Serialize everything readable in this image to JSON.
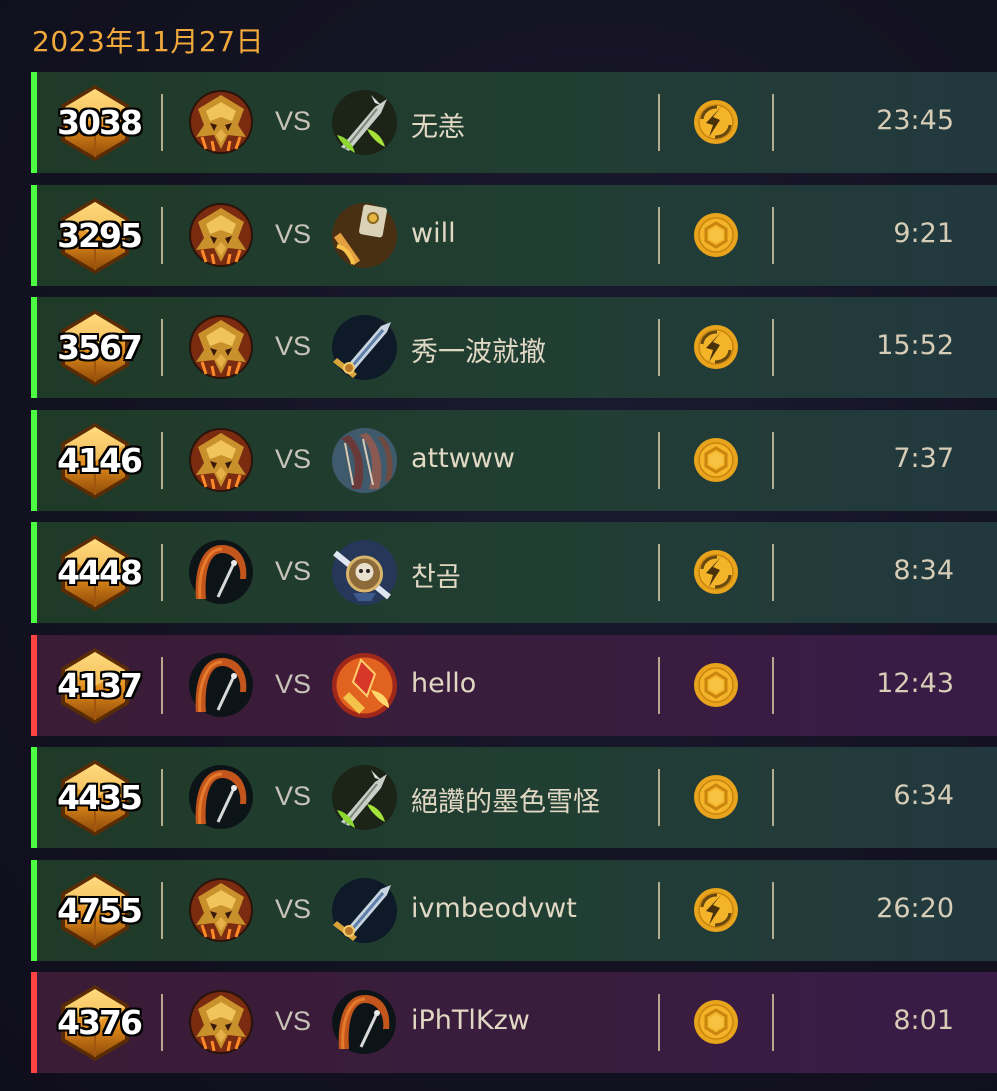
{
  "date": "2023年11月27日",
  "vs_label": "VS",
  "colors": {
    "accent": "#f2a93b",
    "win_bar": "#4cff43",
    "loss_bar": "#ff4242"
  },
  "matches": [
    {
      "result": "win",
      "rating": "3038",
      "my_hero": "tribal-mask-icon",
      "opponent_hero": "sword-green-icon",
      "opponent": "无恙",
      "mode": "swirl-mode-icon",
      "duration": "23:45"
    },
    {
      "result": "win",
      "rating": "3295",
      "my_hero": "tribal-mask-icon",
      "opponent_hero": "hammer-icon",
      "opponent": "will",
      "mode": "hexagon-mode-icon",
      "duration": "9:21"
    },
    {
      "result": "win",
      "rating": "3567",
      "my_hero": "tribal-mask-icon",
      "opponent_hero": "sword-blue-icon",
      "opponent": "秀一波就撤",
      "mode": "swirl-mode-icon",
      "duration": "15:52"
    },
    {
      "result": "win",
      "rating": "4146",
      "my_hero": "tribal-mask-icon",
      "opponent_hero": "claw-icon",
      "opponent": "attwww",
      "mode": "hexagon-mode-icon",
      "duration": "7:37"
    },
    {
      "result": "win",
      "rating": "4448",
      "my_hero": "hooded-staff-icon",
      "opponent_hero": "skull-shield-icon",
      "opponent": "찬곰",
      "mode": "swirl-mode-icon",
      "duration": "8:34"
    },
    {
      "result": "loss",
      "rating": "4137",
      "my_hero": "hooded-staff-icon",
      "opponent_hero": "fire-gem-icon",
      "opponent": "hello",
      "mode": "hexagon-mode-icon",
      "duration": "12:43"
    },
    {
      "result": "win",
      "rating": "4435",
      "my_hero": "hooded-staff-icon",
      "opponent_hero": "sword-green-icon",
      "opponent": "絕讚的墨色雪怪",
      "mode": "hexagon-mode-icon",
      "duration": "6:34"
    },
    {
      "result": "win",
      "rating": "4755",
      "my_hero": "tribal-mask-icon",
      "opponent_hero": "sword-blue-icon",
      "opponent": "ivmbeodvwt",
      "mode": "swirl-mode-icon",
      "duration": "26:20"
    },
    {
      "result": "loss",
      "rating": "4376",
      "my_hero": "tribal-mask-icon",
      "opponent_hero": "hooded-staff-icon",
      "opponent": "iPhTlKzw",
      "mode": "hexagon-mode-icon",
      "duration": "8:01"
    }
  ]
}
